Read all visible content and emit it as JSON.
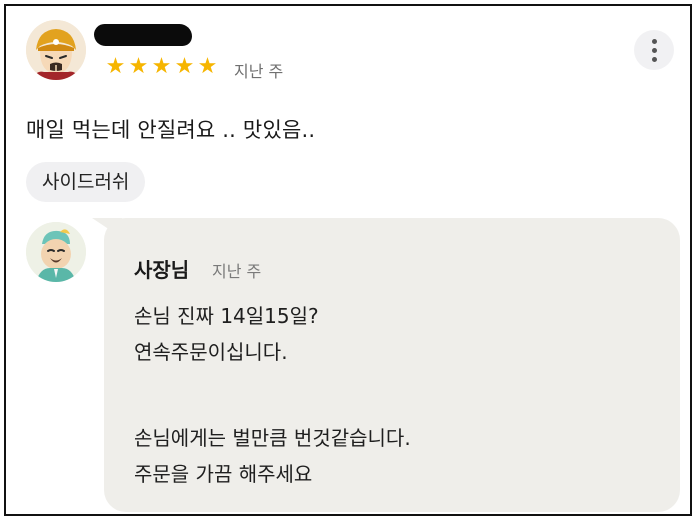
{
  "review": {
    "rating": 5,
    "stars": [
      "★",
      "★",
      "★",
      "★",
      "★"
    ],
    "time": "지난 주",
    "text": "매일 먹는데 안질려요 .. 맛있음..",
    "tag": "사이드러쉬"
  },
  "reply": {
    "author": "사장님",
    "time": "지난 주",
    "lines": [
      "손님 진짜 14일15일?",
      "연속주문이십니다.",
      "",
      "손님에게는 벌만큼 번것같습니다.",
      "주문을 가끔 해주세요"
    ]
  },
  "colors": {
    "star": "#f6b500",
    "bubble": "#efeeea",
    "tag_bg": "#f0f0f2"
  },
  "icons": {
    "more": "more-vertical-icon"
  }
}
